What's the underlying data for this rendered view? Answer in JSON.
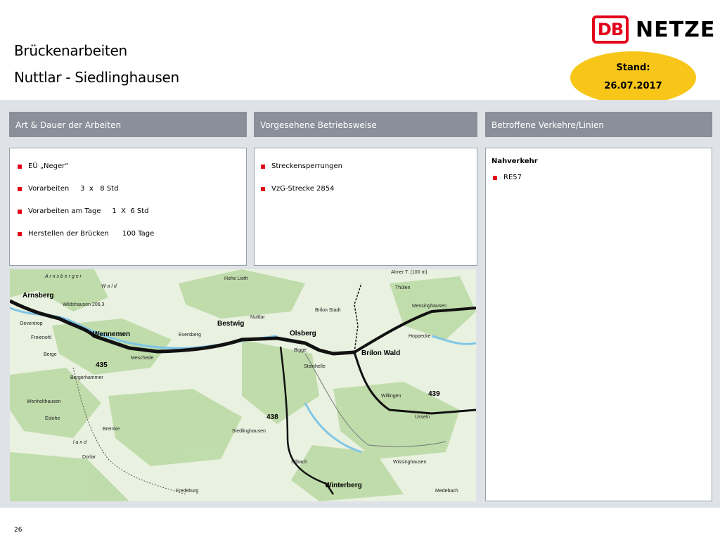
{
  "header": {
    "title_line1": "Brückenarbeiten",
    "title_line2": "Nuttlar - Siedlinghausen",
    "logo_db": "DB",
    "logo_netze": "NETZE",
    "stand_label": "Stand:",
    "stand_date": "26.07.2017"
  },
  "columns": [
    {
      "header": "Art & Dauer der Arbeiten"
    },
    {
      "header": "Vorgesehene Betriebsweise"
    },
    {
      "header": "Betroffene Verkehre/Linien"
    }
  ],
  "works": [
    "EÜ „Neger“",
    "Vorarbeiten     3  x   8 Std",
    "Vorarbeiten am Tage     1  X  6 Std",
    "Herstellen der Brücken      100 Tage"
  ],
  "operation": [
    "Streckensperrungen",
    "VzG-Strecke 2854"
  ],
  "traffic": {
    "heading": "Nahverkehr",
    "lines": [
      "RE57"
    ]
  },
  "map": {
    "big_labels": {
      "arnsberg": "Arnsberg",
      "wennemen": "Wennemen",
      "bestwig": "Bestwig",
      "olsberg": "Olsberg",
      "brilon_wald": "Brilon Wald",
      "winterberg": "Winterberg",
      "r435": "435",
      "r438": "438",
      "r439": "439"
    },
    "small_labels": {
      "arnsberger": "A r n s b e r g e r",
      "wald": "W a l d",
      "land": "l  a  n  d",
      "hohe_lieth": "Hohe Lieth",
      "wildshausen": "Wildshausen 206,3",
      "oeventrop": "Oeventrop",
      "freienohl": "Freienohl",
      "meschede": "Meschede",
      "eversberg": "Eversberg",
      "nuttlar": "Nuttlar",
      "bigge": "Bigge",
      "brilon_stadt": "Brilon Stadt",
      "messinghausen": "Messinghausen",
      "hoppecke": "Hoppecke",
      "willingen": "Willingen",
      "usseln": "Usseln",
      "siedlinghausen": "Siedlinghausen",
      "silbach": "Silbach",
      "wissinghausen": "Wissinghausen",
      "medebach": "Medebach",
      "berge": "Berge",
      "bergerhammer": "Bergerhammer",
      "wenholthausen": "Wenholthausen",
      "eslohe": "Eslohe",
      "bremke": "Bremke",
      "dorlar": "Dorlar",
      "fredeburg": "Fredeburg",
      "steinhelle": "Steinhelle",
      "thulen": "Thülen",
      "almer": "Almer T. (100 m)"
    }
  }
}
